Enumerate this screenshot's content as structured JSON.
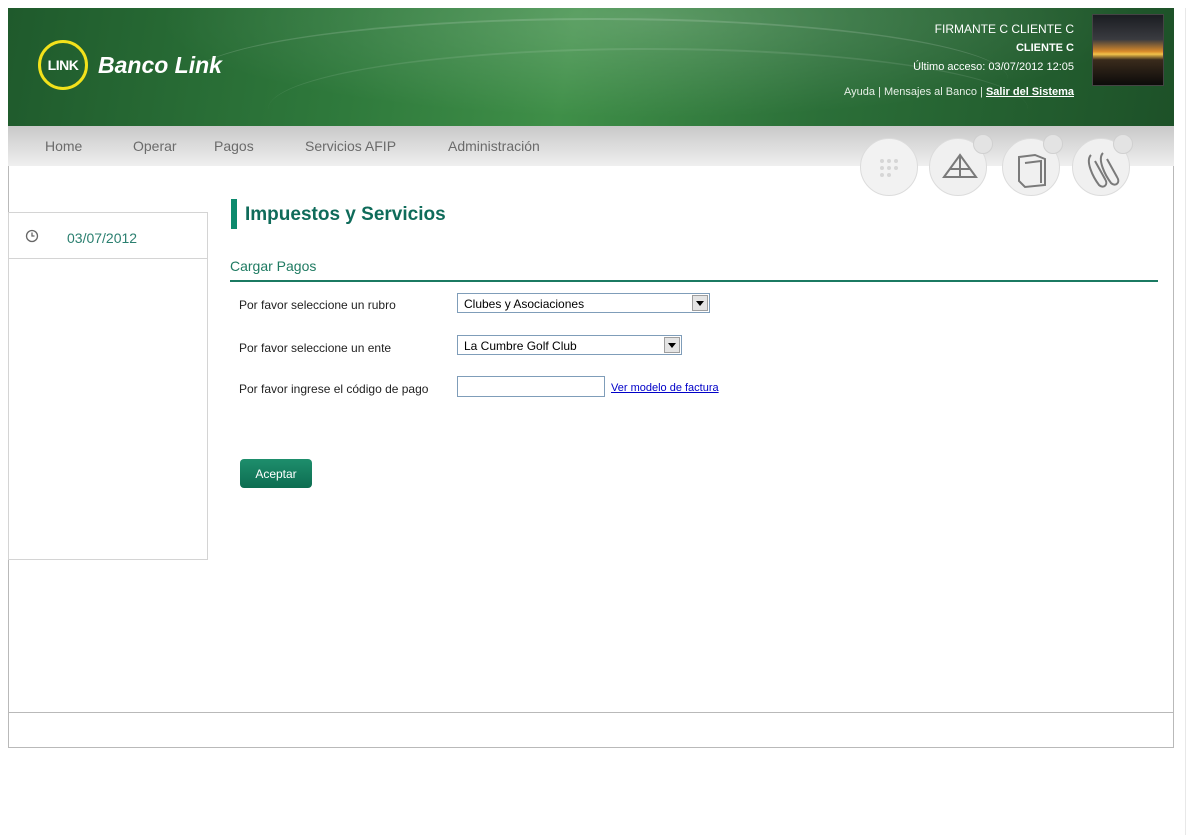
{
  "brand": {
    "logo_text": "LINK",
    "name": "Banco Link"
  },
  "user": {
    "name": "FIRMANTE C CLIENTE C",
    "client": "CLIENTE C",
    "last_access": "Último acceso: 03/07/2012 12:05",
    "help": "Ayuda",
    "messages": "Mensajes al Banco",
    "logout": "Salir del Sistema"
  },
  "nav": {
    "items": [
      "Home",
      "Operar",
      "Pagos",
      "Servicios AFIP",
      "Administración"
    ],
    "icons": [
      "calendar-icon",
      "mail-icon",
      "folder-icon",
      "paperclip-icon"
    ]
  },
  "sidebar": {
    "date": "03/07/2012"
  },
  "page": {
    "title": "Impuestos y Servicios",
    "section": "Cargar Pagos",
    "rubro_label": "Por favor seleccione un rubro",
    "rubro_value": "Clubes y Asociaciones",
    "ente_label": "Por favor seleccione un ente",
    "ente_value": "La Cumbre Golf Club",
    "codigo_label": "Por favor ingrese el código de pago",
    "codigo_value": "",
    "invoice_link": "Ver modelo de factura",
    "accept_button": "Aceptar"
  },
  "colors": {
    "header_green": "#2f7a3c",
    "accent_teal": "#0d8a6d",
    "link_blue": "#0000c8"
  }
}
